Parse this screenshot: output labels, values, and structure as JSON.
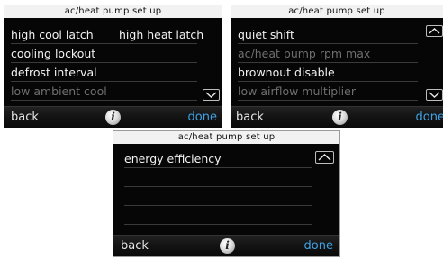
{
  "screens": [
    {
      "header": "ac/heat pump set up",
      "rows": [
        {
          "label": "high cool latch",
          "label2": "high heat latch",
          "enabled": true
        },
        {
          "label": "cooling lockout",
          "enabled": true
        },
        {
          "label": "defrost interval",
          "enabled": true
        },
        {
          "label": "low ambient cool",
          "enabled": false
        }
      ],
      "scroll": "down",
      "footer": {
        "back_label": "back",
        "info_label": "i",
        "done_label": "done"
      }
    },
    {
      "header": "ac/heat pump set up",
      "rows": [
        {
          "label": "quiet shift",
          "enabled": true
        },
        {
          "label": "ac/heat pump rpm max",
          "enabled": false
        },
        {
          "label": "brownout disable",
          "enabled": true
        },
        {
          "label": "low airflow multiplier",
          "enabled": false
        }
      ],
      "scroll": "up-down",
      "footer": {
        "back_label": "back",
        "info_label": "i",
        "done_label": "done"
      }
    },
    {
      "header": "ac/heat pump set up",
      "rows": [
        {
          "label": "energy efficiency",
          "enabled": true
        }
      ],
      "scroll": "up",
      "footer": {
        "back_label": "back",
        "info_label": "i",
        "done_label": "done"
      }
    }
  ],
  "colors": {
    "header_bg": "#f2f2f2",
    "screen_bg": "#000000",
    "text_enabled": "#f2f2f2",
    "text_disabled": "#6f6f6f",
    "done_accent": "#3ea3e6"
  },
  "icons": [
    "info-icon",
    "chevron-up-icon",
    "chevron-down-icon"
  ]
}
